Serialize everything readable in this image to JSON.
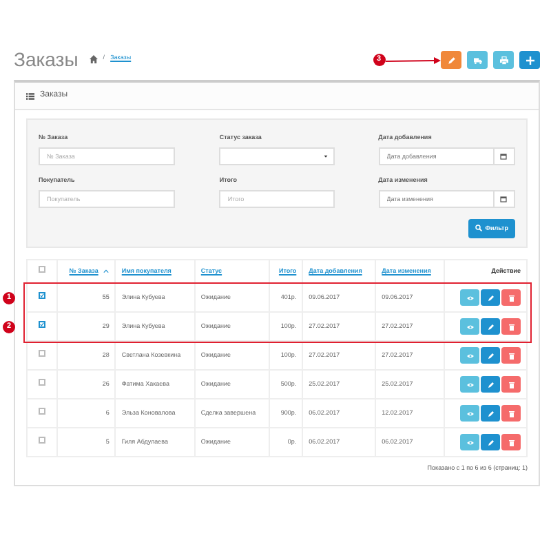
{
  "page": {
    "title": "Заказы",
    "breadcrumb_separator": "/",
    "breadcrumb": "Заказы"
  },
  "header_buttons": [
    {
      "kind": "edit",
      "color": "#f0883a",
      "marker": "3"
    },
    {
      "kind": "ship",
      "color": "#5bc0de"
    },
    {
      "kind": "print",
      "color": "#5bc0de"
    },
    {
      "kind": "add",
      "color": "#1e91cf"
    }
  ],
  "panel": {
    "title": "Заказы"
  },
  "filter": {
    "fields": [
      {
        "label": "№ Заказа",
        "kind": "text",
        "placeholder": "№ Заказа"
      },
      {
        "label": "Статус заказа",
        "kind": "select"
      },
      {
        "label": "Дата добавления",
        "kind": "date",
        "placeholder": "Дата добавления"
      },
      {
        "label": "Покупатель",
        "kind": "text",
        "placeholder": "Покупатель"
      },
      {
        "label": "Итого",
        "kind": "text",
        "placeholder": "Итого"
      },
      {
        "label": "Дата изменения",
        "kind": "date",
        "placeholder": "Дата изменения"
      }
    ],
    "button": "Фильтр"
  },
  "table": {
    "select_all_checked": false,
    "columns": [
      {
        "label": "№ Заказа",
        "kind": "number",
        "link": true,
        "sorted": true
      },
      {
        "label": "Имя покупателя",
        "kind": "text",
        "link": true,
        "sorted": false
      },
      {
        "label": "Статус",
        "kind": "text",
        "link": true,
        "sorted": false
      },
      {
        "label": "Итого",
        "kind": "number",
        "link": true,
        "sorted": false
      },
      {
        "label": "Дата добавления",
        "kind": "text",
        "link": true,
        "sorted": false
      },
      {
        "label": "Дата изменения",
        "kind": "text",
        "link": true,
        "sorted": false
      },
      {
        "label": "Действие",
        "kind": "action",
        "link": false
      }
    ],
    "rows": [
      {
        "checked": true,
        "highlighted": true,
        "marker": "1",
        "cells": [
          "55",
          "Элина Кубуева",
          "Ожидание",
          "401р.",
          "09.06.2017",
          "09.06.2017"
        ]
      },
      {
        "checked": true,
        "highlighted": true,
        "marker": "2",
        "cells": [
          "29",
          "Элина Кубуева",
          "Ожидание",
          "100р.",
          "27.02.2017",
          "27.02.2017"
        ]
      },
      {
        "checked": false,
        "highlighted": false,
        "cells": [
          "28",
          "Светлана Козевкина",
          "Ожидание",
          "100р.",
          "27.02.2017",
          "27.02.2017"
        ]
      },
      {
        "checked": false,
        "highlighted": false,
        "cells": [
          "26",
          "Фатима Хакаева",
          "Ожидание",
          "500р.",
          "25.02.2017",
          "25.02.2017"
        ]
      },
      {
        "checked": false,
        "highlighted": false,
        "cells": [
          "6",
          "Эльза Коновалова",
          "Сделка завершена",
          "900р.",
          "06.02.2017",
          "12.02.2017"
        ]
      },
      {
        "checked": false,
        "highlighted": false,
        "cells": [
          "5",
          "Гиля Абдулаева",
          "Ожидание",
          "0р.",
          "06.02.2017",
          "06.02.2017"
        ]
      }
    ]
  },
  "pagination": {
    "summary": "Показано с 1 по 6 из 6 (страниц: 1)"
  }
}
